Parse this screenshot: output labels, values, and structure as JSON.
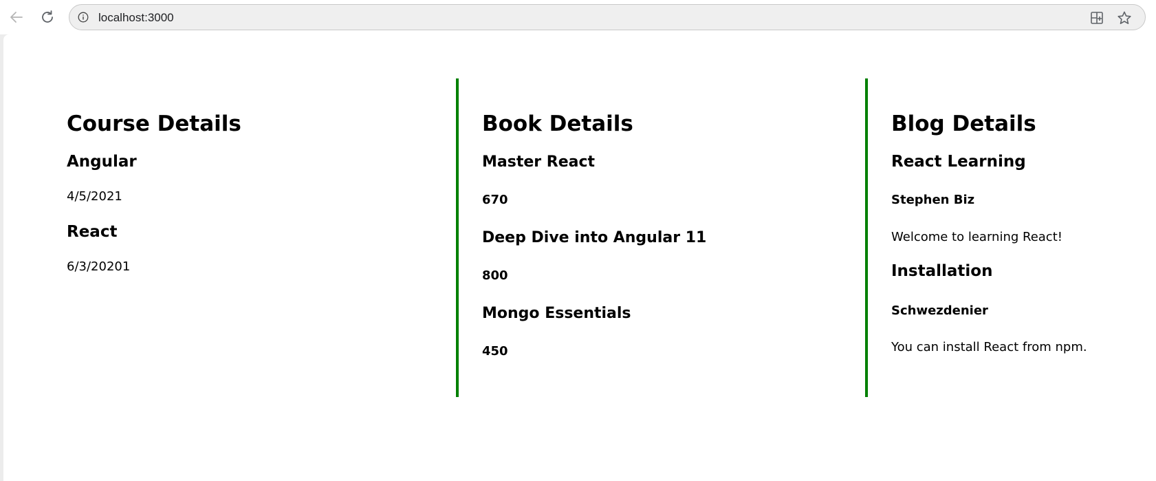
{
  "browser": {
    "url": "localhost:3000"
  },
  "course": {
    "title": "Course Details",
    "items": [
      {
        "name": "Angular",
        "date": "4/5/2021"
      },
      {
        "name": "React",
        "date": "6/3/20201"
      }
    ]
  },
  "book": {
    "title": "Book Details",
    "items": [
      {
        "name": "Master React",
        "price": "670"
      },
      {
        "name": "Deep Dive into Angular 11",
        "price": "800"
      },
      {
        "name": "Mongo Essentials",
        "price": "450"
      }
    ]
  },
  "blog": {
    "title": "Blog Details",
    "items": [
      {
        "title": "React Learning",
        "author": "Stephen Biz",
        "content": "Welcome to learning React!"
      },
      {
        "title": "Installation",
        "author": "Schwezdenier",
        "content": "You can install React from npm."
      }
    ]
  },
  "colors": {
    "divider": "#008000"
  }
}
